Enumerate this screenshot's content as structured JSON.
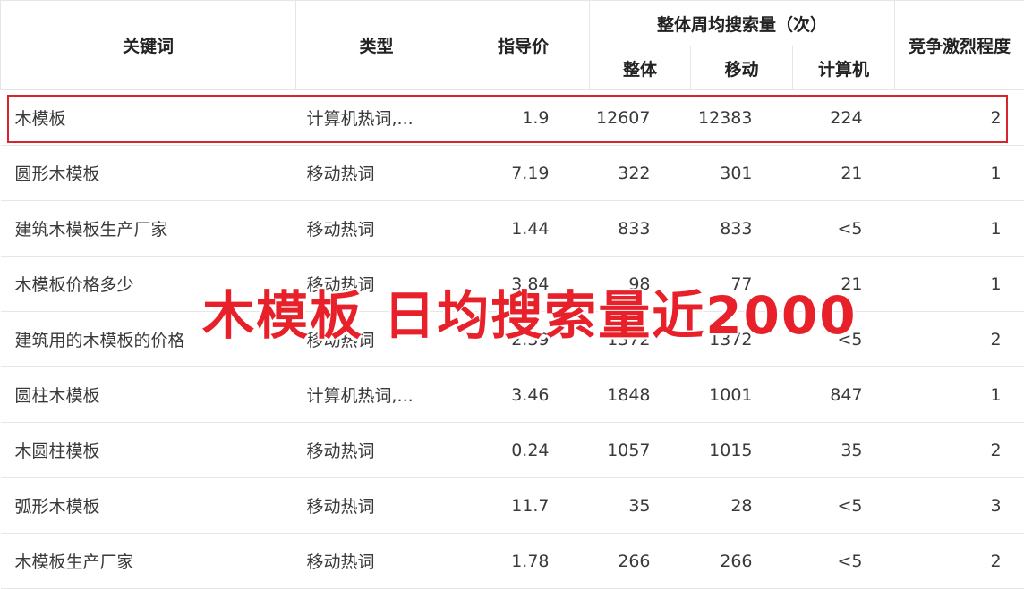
{
  "header": {
    "keyword": "关键词",
    "type": "类型",
    "price": "指导价",
    "weekly_group": "整体周均搜索量（次）",
    "overall": "整体",
    "mobile": "移动",
    "pc": "计算机",
    "competition": "竞争激烈程度"
  },
  "rows": [
    {
      "keyword": "木模板",
      "type": "计算机热词,...",
      "price": "1.9",
      "overall": "12607",
      "mobile": "12383",
      "pc": "224",
      "competition": "2"
    },
    {
      "keyword": "圆形木模板",
      "type": "移动热词",
      "price": "7.19",
      "overall": "322",
      "mobile": "301",
      "pc": "21",
      "competition": "1"
    },
    {
      "keyword": "建筑木模板生产厂家",
      "type": "移动热词",
      "price": "1.44",
      "overall": "833",
      "mobile": "833",
      "pc": "<5",
      "competition": "1"
    },
    {
      "keyword": "木模板价格多少",
      "type": "移动热词",
      "price": "3.84",
      "overall": "98",
      "mobile": "77",
      "pc": "21",
      "competition": "1"
    },
    {
      "keyword": "建筑用的木模板的价格",
      "type": "移动热词",
      "price": "2.39",
      "overall": "1372",
      "mobile": "1372",
      "pc": "<5",
      "competition": "2"
    },
    {
      "keyword": "圆柱木模板",
      "type": "计算机热词,...",
      "price": "3.46",
      "overall": "1848",
      "mobile": "1001",
      "pc": "847",
      "competition": "1"
    },
    {
      "keyword": "木圆柱模板",
      "type": "移动热词",
      "price": "0.24",
      "overall": "1057",
      "mobile": "1015",
      "pc": "35",
      "competition": "2"
    },
    {
      "keyword": "弧形木模板",
      "type": "移动热词",
      "price": "11.7",
      "overall": "35",
      "mobile": "28",
      "pc": "<5",
      "competition": "3"
    },
    {
      "keyword": "木模板生产厂家",
      "type": "移动热词",
      "price": "1.78",
      "overall": "266",
      "mobile": "266",
      "pc": "<5",
      "competition": "2"
    }
  ],
  "overlay_text": "木模板  日均搜索量近2000",
  "colors": {
    "accent_red": "#e8202a",
    "highlight_border": "#d9232d"
  }
}
